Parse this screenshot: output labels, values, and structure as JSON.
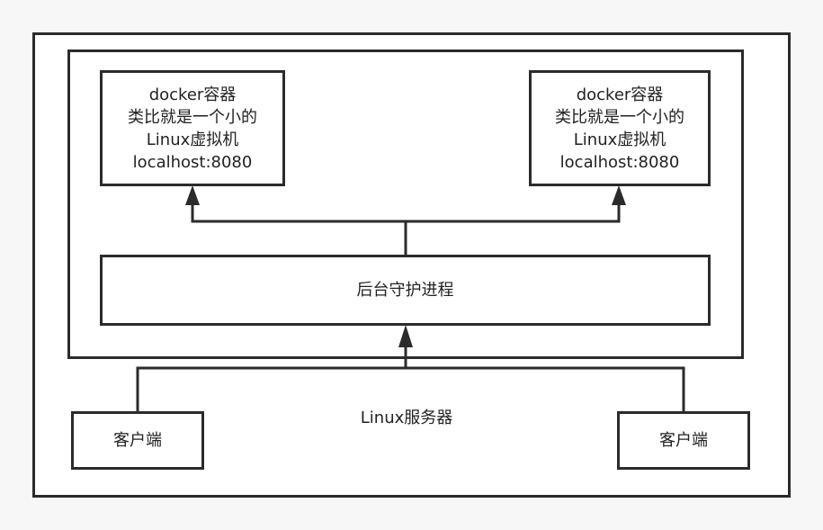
{
  "server": {
    "label": "Linux服务器"
  },
  "daemon": {
    "label": "后台守护进程"
  },
  "containers": [
    {
      "line1": "docker容器",
      "line2": "类比就是一个小的",
      "line3": "Linux虚拟机",
      "line4": "localhost:8080"
    },
    {
      "line1": "docker容器",
      "line2": "类比就是一个小的",
      "line3": "Linux虚拟机",
      "line4": "localhost:8080"
    }
  ],
  "clients": [
    {
      "label": "客户端"
    },
    {
      "label": "客户端"
    }
  ],
  "colors": {
    "line": "#2b2b2b",
    "box_fill": "#ffffff",
    "background": "#f7f7f7"
  }
}
